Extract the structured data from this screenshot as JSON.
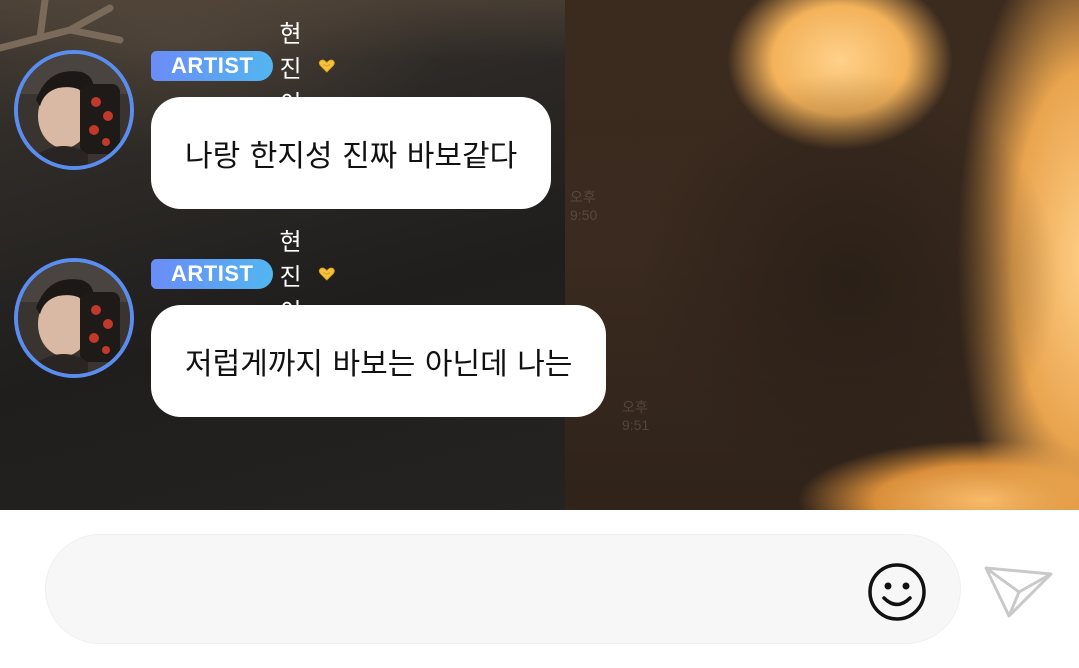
{
  "messages": [
    {
      "badge": "ARTIST",
      "sender": "현진이",
      "text": "나랑 한지성 진짜 바보같다",
      "read_status": "오후 9:50"
    },
    {
      "badge": "ARTIST",
      "sender": "현진이",
      "text": "저럽게까지 바보는 아닌데 나는",
      "read_status": "오후 9:51"
    }
  ],
  "composer": {
    "placeholder": "",
    "value": ""
  },
  "icons": {
    "heart": "heart-hands-icon",
    "emoji": "smiley-face-icon",
    "send": "paper-plane-icon"
  },
  "colors": {
    "badge_start": "#6a8cf7",
    "badge_end": "#52b6f0",
    "avatar_ring": "#5b8def",
    "bubble": "#ffffff"
  }
}
